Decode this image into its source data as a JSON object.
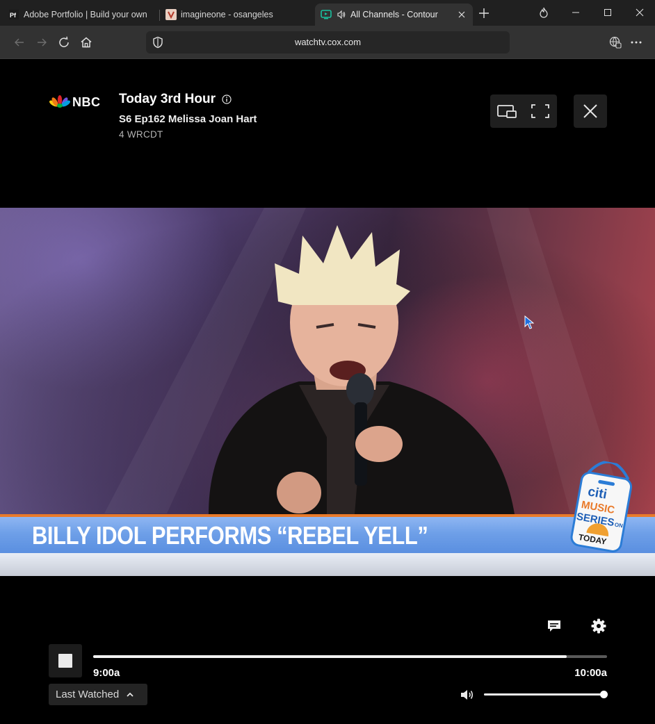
{
  "browser": {
    "tabs": [
      {
        "title": "Adobe Portfolio | Build your own",
        "favicon": "adobe-portfolio-icon",
        "active": false
      },
      {
        "title": "imagineone - osangeles",
        "favicon": "site-favicon-icon",
        "active": false
      },
      {
        "title": "All Channels - Contour",
        "favicon": "contour-tv-icon",
        "active": true,
        "playing_audio": true
      }
    ],
    "address": {
      "url": "watchtv.cox.com"
    },
    "colors": {
      "tabbar": "#202020",
      "toolbar": "#323232"
    }
  },
  "player": {
    "network": {
      "logo_text": "NBC",
      "logo_icon": "nbc-peacock-icon"
    },
    "show_title": "Today 3rd Hour",
    "episode": "S6 Ep162 Melissa Joan Hart",
    "channel": "4  WRCDT",
    "video": {
      "caption": "BILLY IDOL PERFORMS “REBEL YELL”",
      "badge": {
        "line1": "citi",
        "line2": "MUSIC",
        "line3": "SERIES",
        "line4": "ON",
        "line5": "TODAY"
      }
    },
    "controls": {
      "start_time": "9:00a",
      "end_time": "10:00a",
      "progress_fraction": 0.922,
      "last_watched_label": "Last Watched",
      "volume_fraction": 1.0
    }
  }
}
